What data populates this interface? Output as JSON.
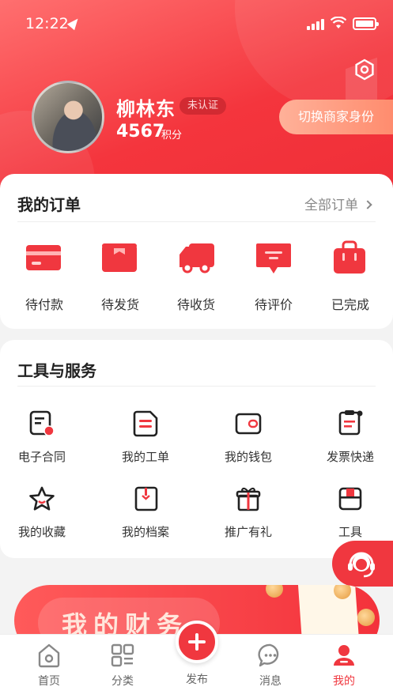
{
  "status_bar": {
    "time": "12:22"
  },
  "profile": {
    "name": "柳林东",
    "verify_badge": "未认证",
    "points": "4567",
    "points_label": "积分",
    "switch_button": "切换商家身份"
  },
  "orders": {
    "title": "我的订单",
    "all_link": "全部订单",
    "items": [
      {
        "label": "待付款",
        "icon": "card-icon"
      },
      {
        "label": "待发货",
        "icon": "box-icon"
      },
      {
        "label": "待收货",
        "icon": "truck-icon"
      },
      {
        "label": "待评价",
        "icon": "comment-icon"
      },
      {
        "label": "已完成",
        "icon": "bag-icon"
      }
    ]
  },
  "tools": {
    "title": "工具与服务",
    "items": [
      {
        "label": "电子合同",
        "icon": "contract-icon"
      },
      {
        "label": "我的工单",
        "icon": "work-order-icon"
      },
      {
        "label": "我的钱包",
        "icon": "wallet-icon"
      },
      {
        "label": "发票快递",
        "icon": "invoice-icon"
      },
      {
        "label": "我的收藏",
        "icon": "star-icon"
      },
      {
        "label": "我的档案",
        "icon": "archive-icon"
      },
      {
        "label": "推广有礼",
        "icon": "gift-icon"
      },
      {
        "label": "工具",
        "icon": "toolbox-icon"
      }
    ]
  },
  "banner": {
    "title": "我的财务"
  },
  "tabbar": {
    "items": [
      {
        "label": "首页",
        "icon": "home-icon"
      },
      {
        "label": "分类",
        "icon": "category-icon"
      },
      {
        "label": "发布",
        "icon": "plus-icon"
      },
      {
        "label": "消息",
        "icon": "message-icon"
      },
      {
        "label": "我的",
        "icon": "user-icon"
      }
    ],
    "active_color": "#f0373f"
  },
  "colors": {
    "primary": "#f0373f",
    "text": "#222222",
    "muted": "#888888"
  }
}
